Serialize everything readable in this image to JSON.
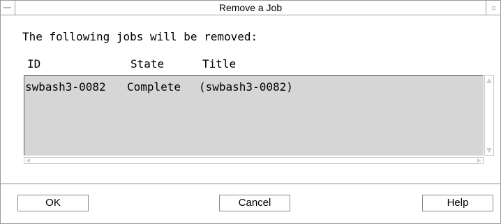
{
  "window": {
    "title": "Remove a Job"
  },
  "message": "The following jobs will be removed:",
  "columns": {
    "id": "ID",
    "state": "State",
    "title": "Title"
  },
  "jobs": [
    {
      "id": "swbash3-0082",
      "state": "Complete",
      "title": "(swbash3-0082)"
    }
  ],
  "buttons": {
    "ok": "OK",
    "cancel": "Cancel",
    "help": "Help"
  },
  "icons": {
    "window_menu": "window-menu-icon",
    "maximize": "maximize-icon",
    "scroll_up": "scroll-up-arrow-icon",
    "scroll_down": "scroll-down-arrow-icon",
    "scroll_left": "scroll-left-arrow-icon",
    "scroll_right": "scroll-right-arrow-icon"
  },
  "colors": {
    "list_background": "#d6d6d6",
    "border": "#9a9a9a"
  }
}
